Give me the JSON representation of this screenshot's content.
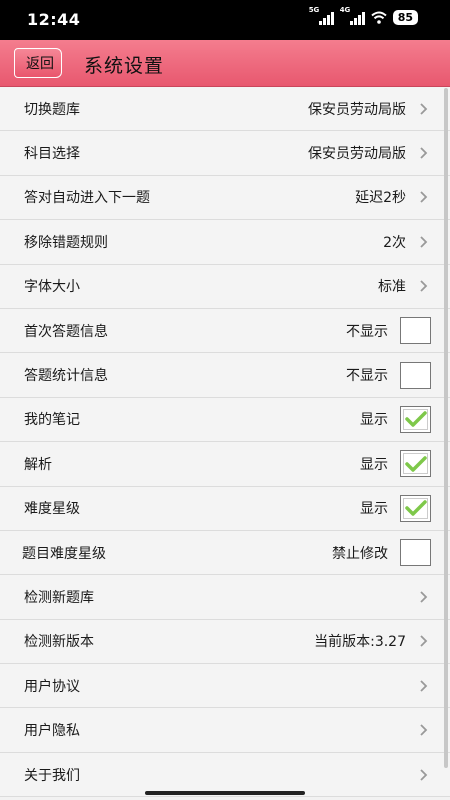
{
  "status": {
    "time": "12:44",
    "net1": "5G",
    "net2": "4G",
    "battery": "85"
  },
  "nav": {
    "back_label": "返回",
    "title": "系统设置"
  },
  "rows": [
    {
      "label": "切换题库",
      "value": "保安员劳动局版"
    },
    {
      "label": "科目选择",
      "value": "保安员劳动局版"
    },
    {
      "label": "答对自动进入下一题",
      "value": "延迟2秒"
    },
    {
      "label": "移除错题规则",
      "value": "2次"
    },
    {
      "label": "字体大小",
      "value": "标准"
    },
    {
      "label": "首次答题信息",
      "value": "不显示",
      "checked": false
    },
    {
      "label": "答题统计信息",
      "value": "不显示",
      "checked": false
    },
    {
      "label": "我的笔记",
      "value": "显示",
      "checked": true
    },
    {
      "label": "解析",
      "value": "显示",
      "checked": true
    },
    {
      "label": "难度星级",
      "value": "显示",
      "checked": true
    },
    {
      "label": "题目难度星级",
      "value": "禁止修改",
      "checked": false
    },
    {
      "label": "检测新题库",
      "value": ""
    },
    {
      "label": "检测新版本",
      "value": "当前版本:3.27"
    },
    {
      "label": "用户协议",
      "value": ""
    },
    {
      "label": "用户隐私",
      "value": ""
    },
    {
      "label": "关于我们",
      "value": ""
    }
  ],
  "colors": {
    "nav_top": "#f47d8e",
    "nav_bottom": "#e8586f",
    "check_green": "#7ec84a"
  }
}
